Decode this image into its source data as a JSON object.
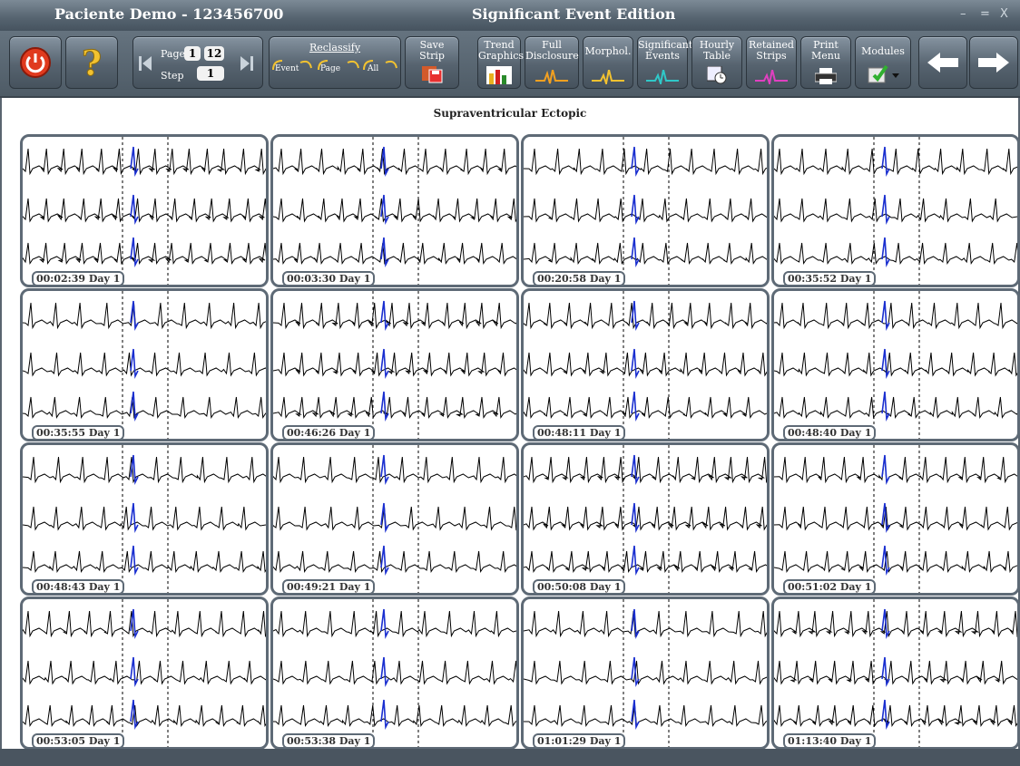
{
  "window": {
    "patient_title": "Paciente Demo - 123456700",
    "app_title": "Significant Event Edition",
    "controls": [
      "–",
      "=",
      "X"
    ]
  },
  "toolbar": {
    "page_label": "Page",
    "page_current": "1",
    "page_total": "12",
    "step_label": "Step",
    "step_value": "1",
    "reclassify_label": "Reclassify",
    "reclass_event": "Event",
    "reclass_page": "Page",
    "reclass_all": "All",
    "save_strip": "Save Strip",
    "trend_graphics": "Trend\nGraphics",
    "full_disclosure": "Full\nDisclosure",
    "morphol": "Morphol.",
    "significant_events": "Significant\nEvents",
    "hourly_table": "Hourly\nTable",
    "retained_strips": "Retained\nStrips",
    "print_menu": "Print\nMenu",
    "modules": "Modules",
    "icons": [
      "power-icon",
      "help-icon",
      "first-page-icon",
      "last-page-icon",
      "save-strip-icon",
      "bar-chart-icon",
      "ecg-wave-icon",
      "calendar-clock-icon",
      "printer-icon",
      "modules-icon",
      "arrow-left-icon",
      "arrow-right-icon"
    ]
  },
  "main": {
    "subtitle": "Supraventricular Ectopic",
    "strips": [
      {
        "time": "00:02:39 Day 1"
      },
      {
        "time": "00:03:30 Day 1"
      },
      {
        "time": "00:20:58 Day 1"
      },
      {
        "time": "00:35:52 Day 1"
      },
      {
        "time": "00:35:55 Day 1"
      },
      {
        "time": "00:46:26 Day 1"
      },
      {
        "time": "00:48:11 Day 1"
      },
      {
        "time": "00:48:40 Day 1"
      },
      {
        "time": "00:48:43 Day 1"
      },
      {
        "time": "00:49:21 Day 1"
      },
      {
        "time": "00:50:08 Day 1"
      },
      {
        "time": "00:51:02 Day 1"
      },
      {
        "time": "00:53:05 Day 1"
      },
      {
        "time": "00:53:38 Day 1"
      },
      {
        "time": "01:01:29 Day 1"
      },
      {
        "time": "01:13:40 Day 1"
      }
    ]
  },
  "colors": {
    "ecg_normal": "#000000",
    "ecg_event": "#1a2fd0",
    "frame": "#5e6a76"
  }
}
